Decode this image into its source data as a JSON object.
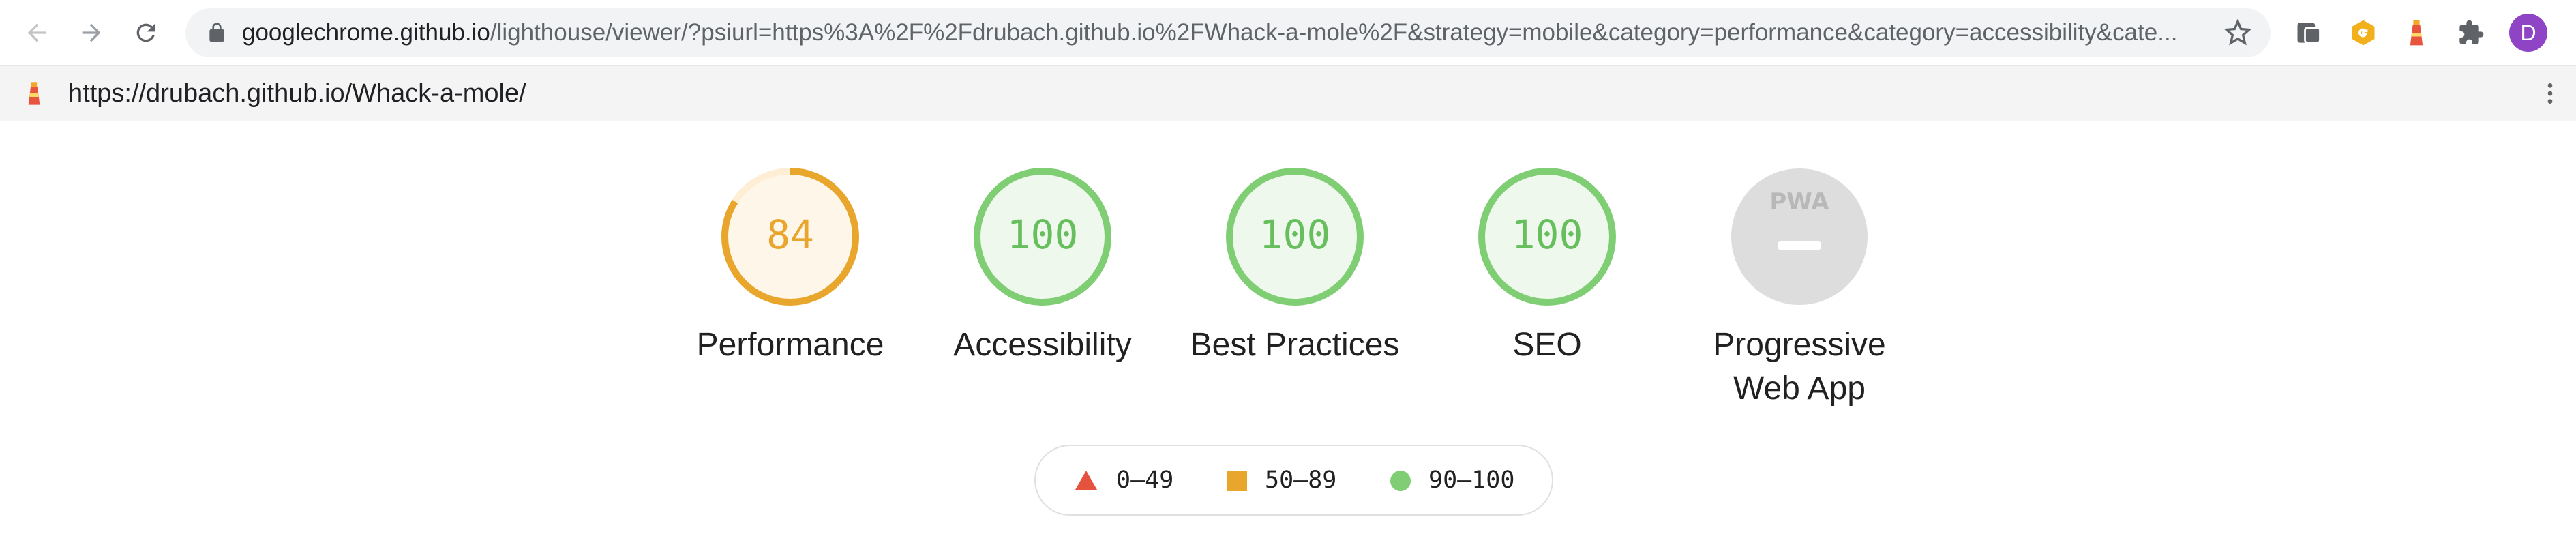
{
  "browser": {
    "address": {
      "host": "googlechrome.github.io",
      "path": "/lighthouse/viewer/?psiurl=https%3A%2F%2Fdrubach.github.io%2FWhack-a-mole%2F&strategy=mobile&category=performance&category=accessibility&cate..."
    },
    "profile_initial": "D"
  },
  "report": {
    "url": "https://drubach.github.io/Whack-a-mole/"
  },
  "gauges": [
    {
      "label": "Performance",
      "score": "84",
      "value": 84,
      "status": "average"
    },
    {
      "label": "Accessibility",
      "score": "100",
      "value": 100,
      "status": "pass"
    },
    {
      "label": "Best Practices",
      "score": "100",
      "value": 100,
      "status": "pass"
    },
    {
      "label": "SEO",
      "score": "100",
      "value": 100,
      "status": "pass"
    },
    {
      "label_line1": "Progressive",
      "label_line2": "Web App",
      "badge": "PWA"
    }
  ],
  "legend": {
    "fail": "0–49",
    "average": "50–89",
    "pass": "90–100"
  },
  "colors": {
    "pass": "#0cce6b",
    "pass_stroke": "#7fce74",
    "pass_text": "#66bf5c",
    "average": "#e8a72c",
    "fail": "#e5533f",
    "pwa_gray": "#dddddd"
  }
}
